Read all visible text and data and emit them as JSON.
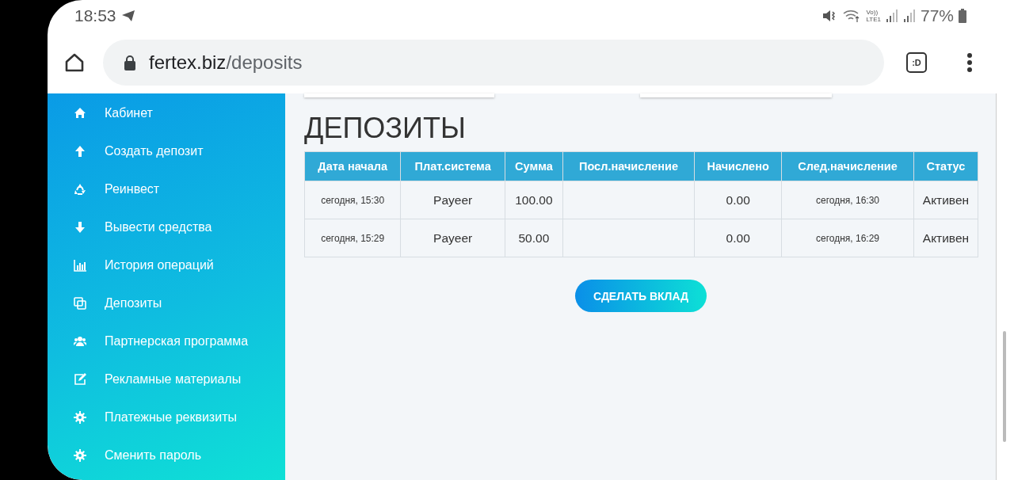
{
  "status_bar": {
    "time": "18:53",
    "network_top": "Vo))",
    "network_bottom": "LTE1",
    "battery": "77%"
  },
  "browser": {
    "host": "fertex.biz",
    "path": "/deposits",
    "tab_button": ":D"
  },
  "sidebar": {
    "items": [
      {
        "label": "Кабинет"
      },
      {
        "label": "Создать депозит"
      },
      {
        "label": "Реинвест"
      },
      {
        "label": "Вывести средства"
      },
      {
        "label": "История операций"
      },
      {
        "label": "Депозиты"
      },
      {
        "label": "Партнерская программа"
      },
      {
        "label": "Рекламные материалы"
      },
      {
        "label": "Платежные реквизиты"
      },
      {
        "label": "Сменить пароль"
      }
    ]
  },
  "page": {
    "title": "ДЕПОЗИТЫ",
    "table": {
      "columns": [
        "Дата начала",
        "Плат.система",
        "Сумма",
        "Посл.начисление",
        "Начислено",
        "След.начисление",
        "Статус"
      ],
      "rows": [
        [
          "сегодня, 15:30",
          "Payeer",
          "100.00",
          "",
          "0.00",
          "сегодня, 16:30",
          "Активен"
        ],
        [
          "сегодня, 15:29",
          "Payeer",
          "50.00",
          "",
          "0.00",
          "сегодня, 16:29",
          "Активен"
        ]
      ]
    },
    "button": "СДЕЛАТЬ ВКЛАД"
  }
}
